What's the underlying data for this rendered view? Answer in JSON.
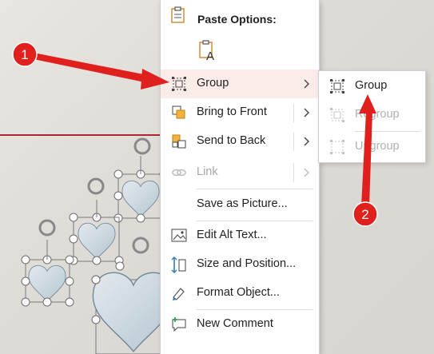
{
  "menu": {
    "header": "Paste Options:",
    "items": [
      {
        "label": "Group",
        "icon": "group-icon",
        "has_submenu": true,
        "highlighted": true
      },
      {
        "label": "Bring to Front",
        "icon": "bring-to-front-icon",
        "has_submenu": true
      },
      {
        "label": "Send to Back",
        "icon": "send-to-back-icon",
        "has_submenu": true
      },
      {
        "label": "Link",
        "icon": "link-icon",
        "has_submenu": true,
        "disabled": true
      },
      {
        "label": "Save as Picture...",
        "icon": ""
      },
      {
        "label": "Edit Alt Text...",
        "icon": "alt-text-icon"
      },
      {
        "label": "Size and Position...",
        "icon": "size-position-icon"
      },
      {
        "label": "Format Object...",
        "icon": "format-object-icon"
      },
      {
        "label": "New Comment",
        "icon": "new-comment-icon"
      }
    ]
  },
  "submenu": {
    "items": [
      {
        "label": "Group",
        "icon": "group-icon",
        "disabled": false
      },
      {
        "label": "Regroup",
        "icon": "regroup-icon",
        "disabled": true
      },
      {
        "label": "Ungroup",
        "icon": "ungroup-icon",
        "disabled": true
      }
    ]
  },
  "callouts": [
    {
      "number": "1"
    },
    {
      "number": "2"
    }
  ],
  "colors": {
    "accent_red": "#e0201c",
    "highlight": "#fbece9",
    "slide_line": "#a8283a",
    "heart_fill": "#c7d3db"
  }
}
